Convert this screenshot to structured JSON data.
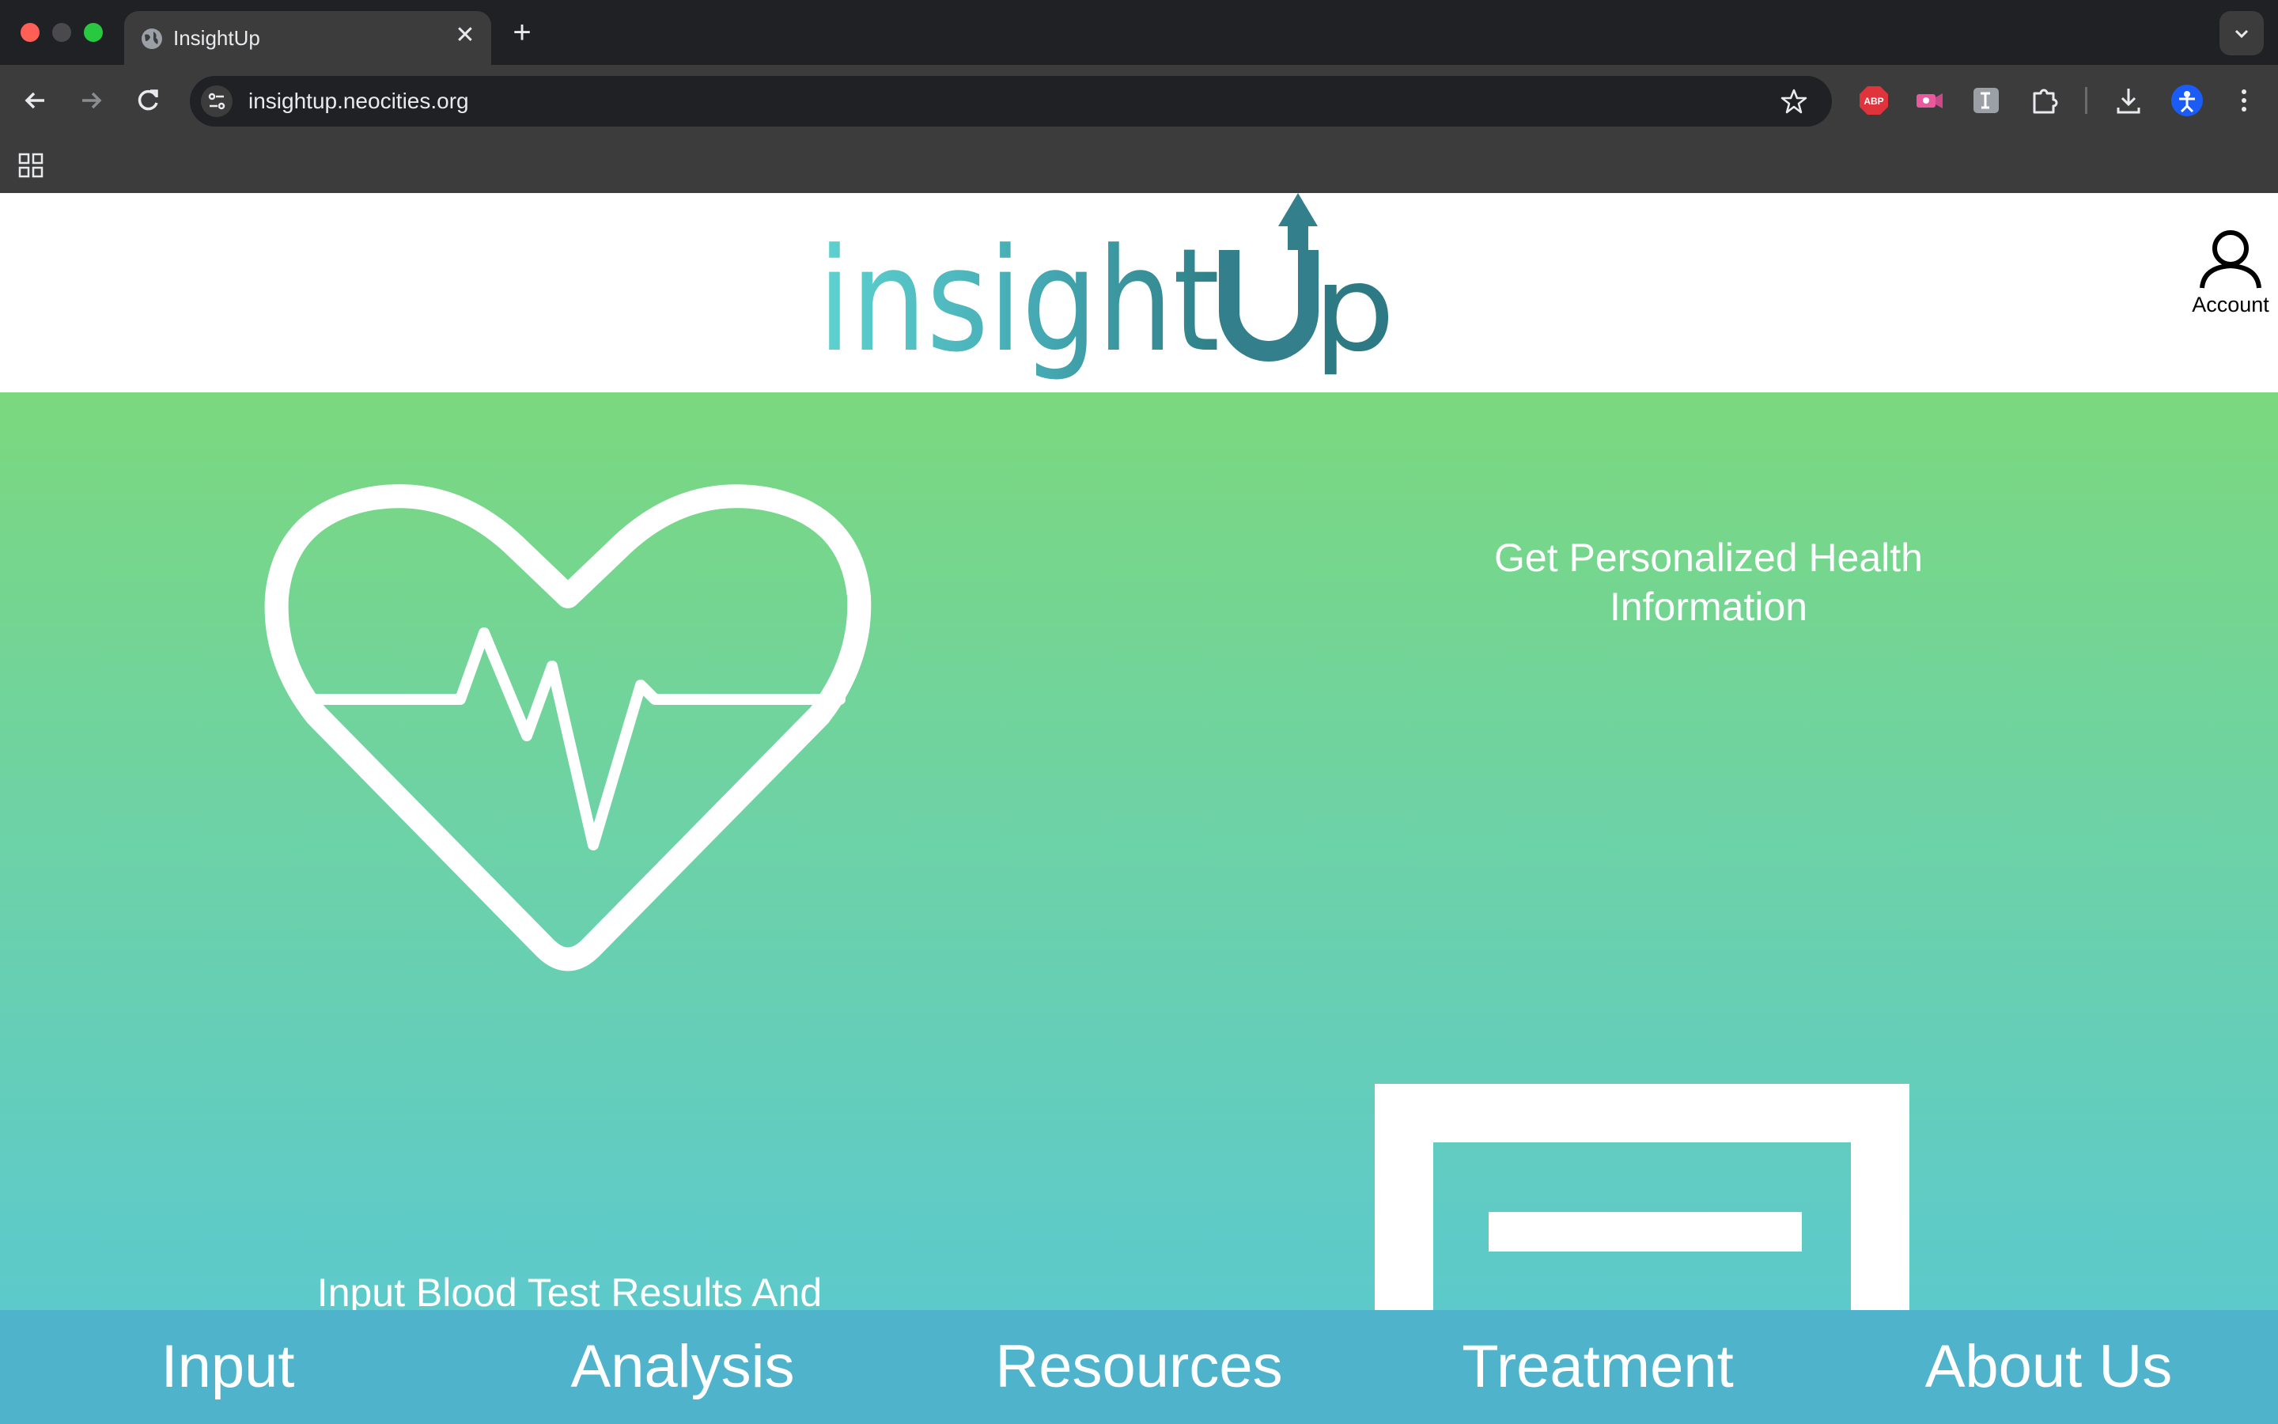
{
  "browser": {
    "tab": {
      "title": "InsightUp"
    },
    "address_bar": {
      "url": "insightup.neocities.org"
    },
    "extensions": [
      "adblock-plus-icon",
      "screen-recorder-icon",
      "extension-icon",
      "puzzle-extensions-icon"
    ],
    "colors": {
      "close": "#ff5f57",
      "minimize": "#3a3a3c",
      "maximize": "#28c840"
    }
  },
  "site": {
    "logo_text": {
      "insight": "insight",
      "u": "U",
      "p": "p"
    },
    "account_label": "Account",
    "hero_title": "Get Personalized Health Information",
    "input_text": "Input Blood Test Results And",
    "nav": [
      "Input",
      "Analysis",
      "Resources",
      "Treatment",
      "About Us"
    ],
    "colors": {
      "header_bg": "#ffffff",
      "gradient_top": "#7bd87e",
      "gradient_bottom": "#5ac7d0",
      "nav_bg": "#4fb3cc",
      "logo_light": "#5ecfd0",
      "logo_dark": "#2f7f87"
    }
  }
}
